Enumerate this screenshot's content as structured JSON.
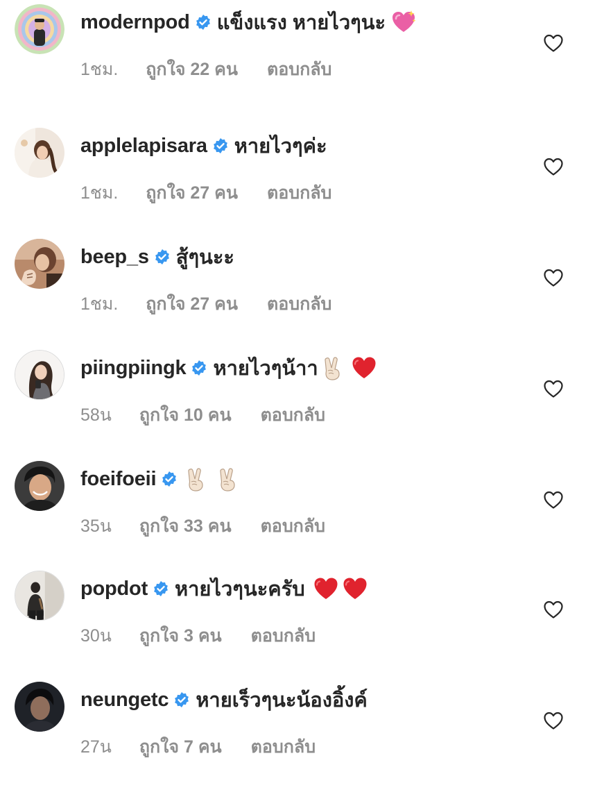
{
  "comments": [
    {
      "username": "modernpod",
      "text": "แข็งแรง หายไวๆนะ",
      "emojis": [
        "sparkling-heart-emoji"
      ],
      "time": "1ชม.",
      "likes": "ถูกใจ 22 คน",
      "reply": "ตอบกลับ",
      "avatar": "avatar-modernpod"
    },
    {
      "username": "applelapisara",
      "text": "หายไวๆค่ะ",
      "emojis": [],
      "time": "1ชม.",
      "likes": "ถูกใจ 27 คน",
      "reply": "ตอบกลับ",
      "avatar": "avatar-applelapisara"
    },
    {
      "username": "beep_s",
      "text": "สู้ๆนะะ",
      "emojis": [],
      "time": "1ชม.",
      "likes": "ถูกใจ 27 คน",
      "reply": "ตอบกลับ",
      "avatar": "avatar-beep-s"
    },
    {
      "username": "piingpiingk",
      "text": "หายไวๆน้าา",
      "emojis": [
        "victory-hand-emoji",
        "red-heart-emoji"
      ],
      "time": "58น",
      "likes": "ถูกใจ 10 คน",
      "reply": "ตอบกลับ",
      "avatar": "avatar-piingpiingk"
    },
    {
      "username": "foeifoeii",
      "text": "",
      "emojis": [
        "victory-hand-emoji",
        "victory-hand-emoji"
      ],
      "time": "35น",
      "likes": "ถูกใจ 33 คน",
      "reply": "ตอบกลับ",
      "avatar": "avatar-foeifoeii"
    },
    {
      "username": "popdot",
      "text": "หายไวๆนะครับ",
      "emojis": [
        "red-heart-emoji",
        "red-heart-emoji"
      ],
      "time": "30น",
      "likes": "ถูกใจ 3 คน",
      "reply": "ตอบกลับ",
      "avatar": "avatar-popdot"
    },
    {
      "username": "neungetc",
      "text": "หายเร็วๆนะน้องอิ้งค์",
      "emojis": [],
      "time": "27น",
      "likes": "ถูกใจ 7 คน",
      "reply": "ตอบกลับ",
      "avatar": "avatar-neungetc"
    }
  ],
  "icons": {
    "verified": "verified-badge-icon",
    "like": "heart-outline-icon"
  },
  "colors": {
    "text_primary": "#262626",
    "text_secondary": "#8e8e8e",
    "verified_blue": "#3897f0",
    "heart_outline": "#262626"
  }
}
